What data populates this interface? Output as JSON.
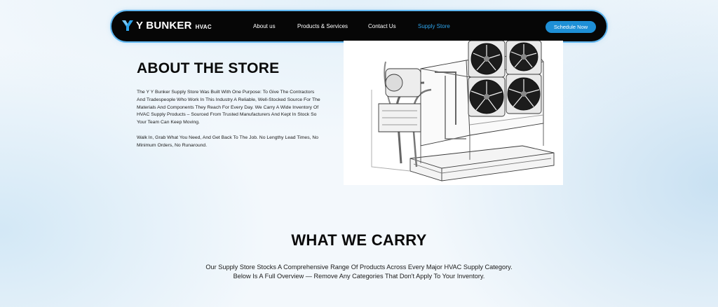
{
  "navbar": {
    "logo_main": "Y BUNKER",
    "logo_sub": "HVAC",
    "links": [
      {
        "label": "About us"
      },
      {
        "label": "Products & Services"
      },
      {
        "label": "Contact Us"
      },
      {
        "label": "Supply Store"
      }
    ],
    "active_link": "Supply Store",
    "cta_label": "Schedule Now"
  },
  "about": {
    "title": "ABOUT THE STORE",
    "paragraph1": "The Y Y Bunker Supply Store Was Built With One Purpose: To Give The Contractors And Tradespeople Who Work In This Industry A Reliable, Well-Stocked Source For The Materials And Components They Reach For Every Day. We Carry A Wide Inventory Of HVAC Supply Products – Sourced From Trusted Manufacturers And Kept In Stock So Your Team Can Keep Moving.",
    "paragraph2": "Walk In, Grab What You Need, And Get Back To The Job. No Lengthy Lead Times, No Minimum Orders, No Runaround."
  },
  "carry": {
    "title": "WHAT WE CARRY",
    "text": "Our Supply Store Stocks A Comprehensive Range Of Products Across Every Major HVAC Supply Category. Below Is A Full Overview — Remove Any Categories That Don't Apply To Your Inventory."
  },
  "colors": {
    "accent": "#1e8fd6",
    "active_link": "#2ea3ea",
    "nav_bg": "#060606",
    "nav_glow": "#5fb6f0"
  }
}
